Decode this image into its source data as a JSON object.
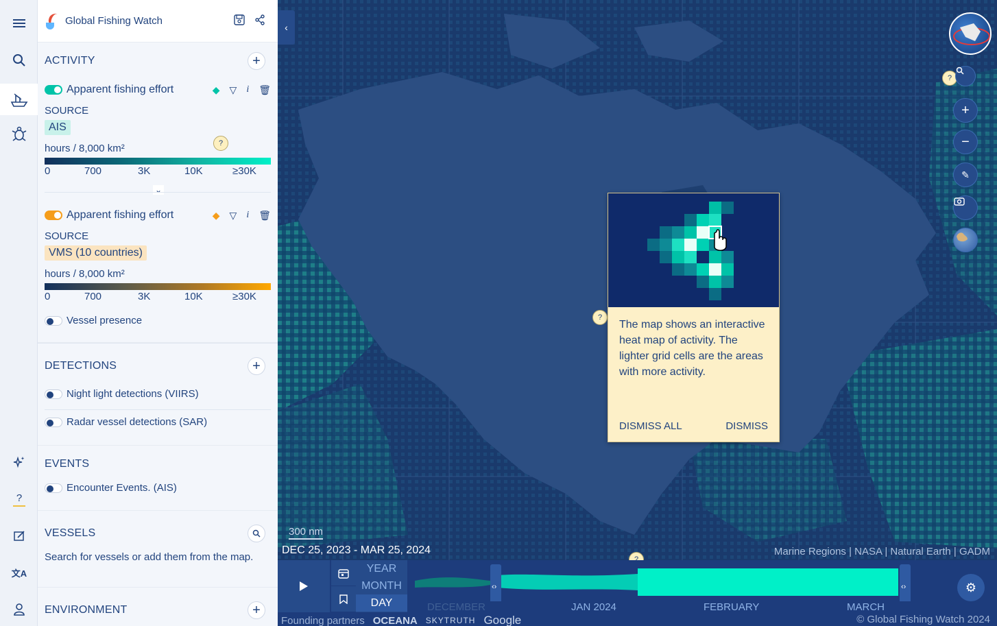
{
  "header": {
    "app_title": "Global Fishing Watch"
  },
  "rail": {
    "icons": [
      "menu-icon",
      "search-icon",
      "vessel-icon",
      "turtle-icon",
      "sparkle-icon",
      "help-icon",
      "feedback-icon",
      "translate-icon",
      "user-icon"
    ]
  },
  "activity": {
    "title": "ACTIVITY",
    "layers": [
      {
        "name": "Apparent fishing effort",
        "source_label": "SOURCE",
        "source": "AIS",
        "unit": "hours / 8,000 km²",
        "ticks": [
          "0",
          "700",
          "3K",
          "10K",
          "≥30K"
        ],
        "color": "#00d3b8"
      },
      {
        "name": "Apparent fishing effort",
        "source_label": "SOURCE",
        "source": "VMS (10 countries)",
        "unit": "hours / 8,000 km²",
        "ticks": [
          "0",
          "700",
          "3K",
          "10K",
          "≥30K"
        ],
        "color": "#f59d1b"
      }
    ],
    "vessel_presence": "Vessel presence"
  },
  "detections": {
    "title": "DETECTIONS",
    "items": [
      "Night light detections (VIIRS)",
      "Radar vessel detections (SAR)"
    ]
  },
  "events": {
    "title": "EVENTS",
    "items": [
      "Encounter Events. (AIS)"
    ]
  },
  "vessels": {
    "title": "VESSELS",
    "text": "Search for vessels or add them from the map."
  },
  "environment": {
    "title": "ENVIRONMENT"
  },
  "map": {
    "scale": "300 nm",
    "date_range": "DEC 25, 2023 - MAR 25, 2024",
    "attribution": "Marine Regions | NASA | Natural Earth | GADM",
    "hint": "?"
  },
  "tooltip": {
    "text": "The map shows an interactive heat map of activity. The lighter grid cells are the areas with more activity.",
    "dismiss_all": "DISMISS ALL",
    "dismiss": "DISMISS"
  },
  "timebar": {
    "scales": [
      "YEAR",
      "MONTH",
      "DAY"
    ],
    "active_scale": "DAY",
    "months": [
      "DECEMBER",
      "JAN 2024",
      "FEBRUARY",
      "MARCH"
    ],
    "partners_label": "Founding partners",
    "partners": [
      "OCEANA",
      "SKYTRUTH",
      "Google"
    ],
    "copyright": "© Global Fishing Watch 2024"
  }
}
